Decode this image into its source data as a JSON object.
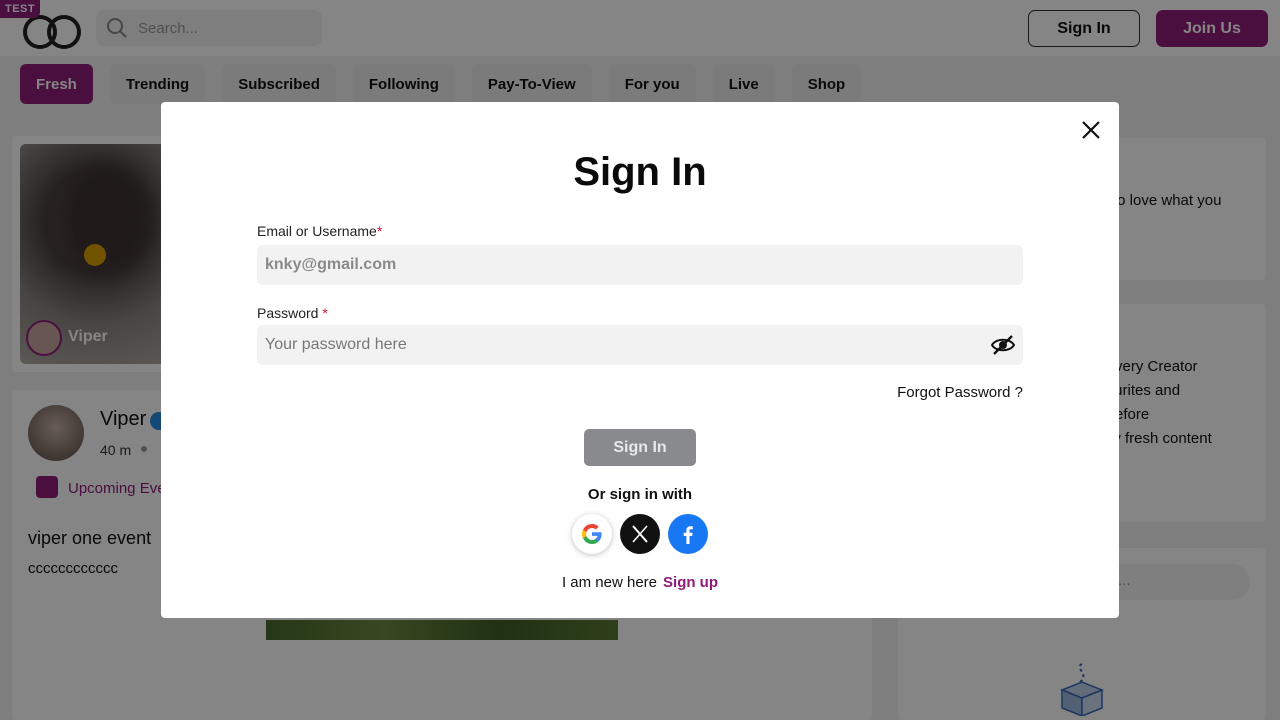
{
  "header": {
    "badge": "TEST",
    "search_placeholder": "Search...",
    "signin_label": "Sign In",
    "join_label": "Join Us"
  },
  "tabs": [
    {
      "label": "Fresh",
      "active": true
    },
    {
      "label": "Trending"
    },
    {
      "label": "Subscribed"
    },
    {
      "label": "Following"
    },
    {
      "label": "Pay-To-View"
    },
    {
      "label": "For you"
    },
    {
      "label": "Live"
    },
    {
      "label": "Shop"
    }
  ],
  "creator_card": {
    "name": "Viper"
  },
  "post": {
    "author": "Viper",
    "time": "40 m",
    "event_label": "Upcoming Eve",
    "title": "viper one event",
    "body": "cccccccccccc"
  },
  "sidebar": {
    "card1_text": "who love what you",
    "card2_lines": [
      "to every Creator",
      "avourites and",
      "nt before",
      "daily fresh content"
    ],
    "card3_placeholder": "..."
  },
  "modal": {
    "title": "Sign In",
    "email_label": "Email or Username",
    "email_required": "*",
    "email_placeholder": "knky@gmail.com",
    "password_label": "Password",
    "password_required": "*",
    "password_placeholder": "Your password here",
    "forgot_label": "Forgot Password ?",
    "submit_label": "Sign In",
    "or_text": "Or sign in with",
    "new_text": "I am new here",
    "signup_label": "Sign up"
  },
  "colors": {
    "brand": "#8e1b7a",
    "submit_disabled": "#888a8e",
    "facebook": "#1877f2"
  },
  "icons": [
    "search-icon",
    "close-icon",
    "eye-off-icon",
    "google-icon",
    "x-icon",
    "facebook-icon",
    "calendar-icon",
    "box-icon"
  ]
}
